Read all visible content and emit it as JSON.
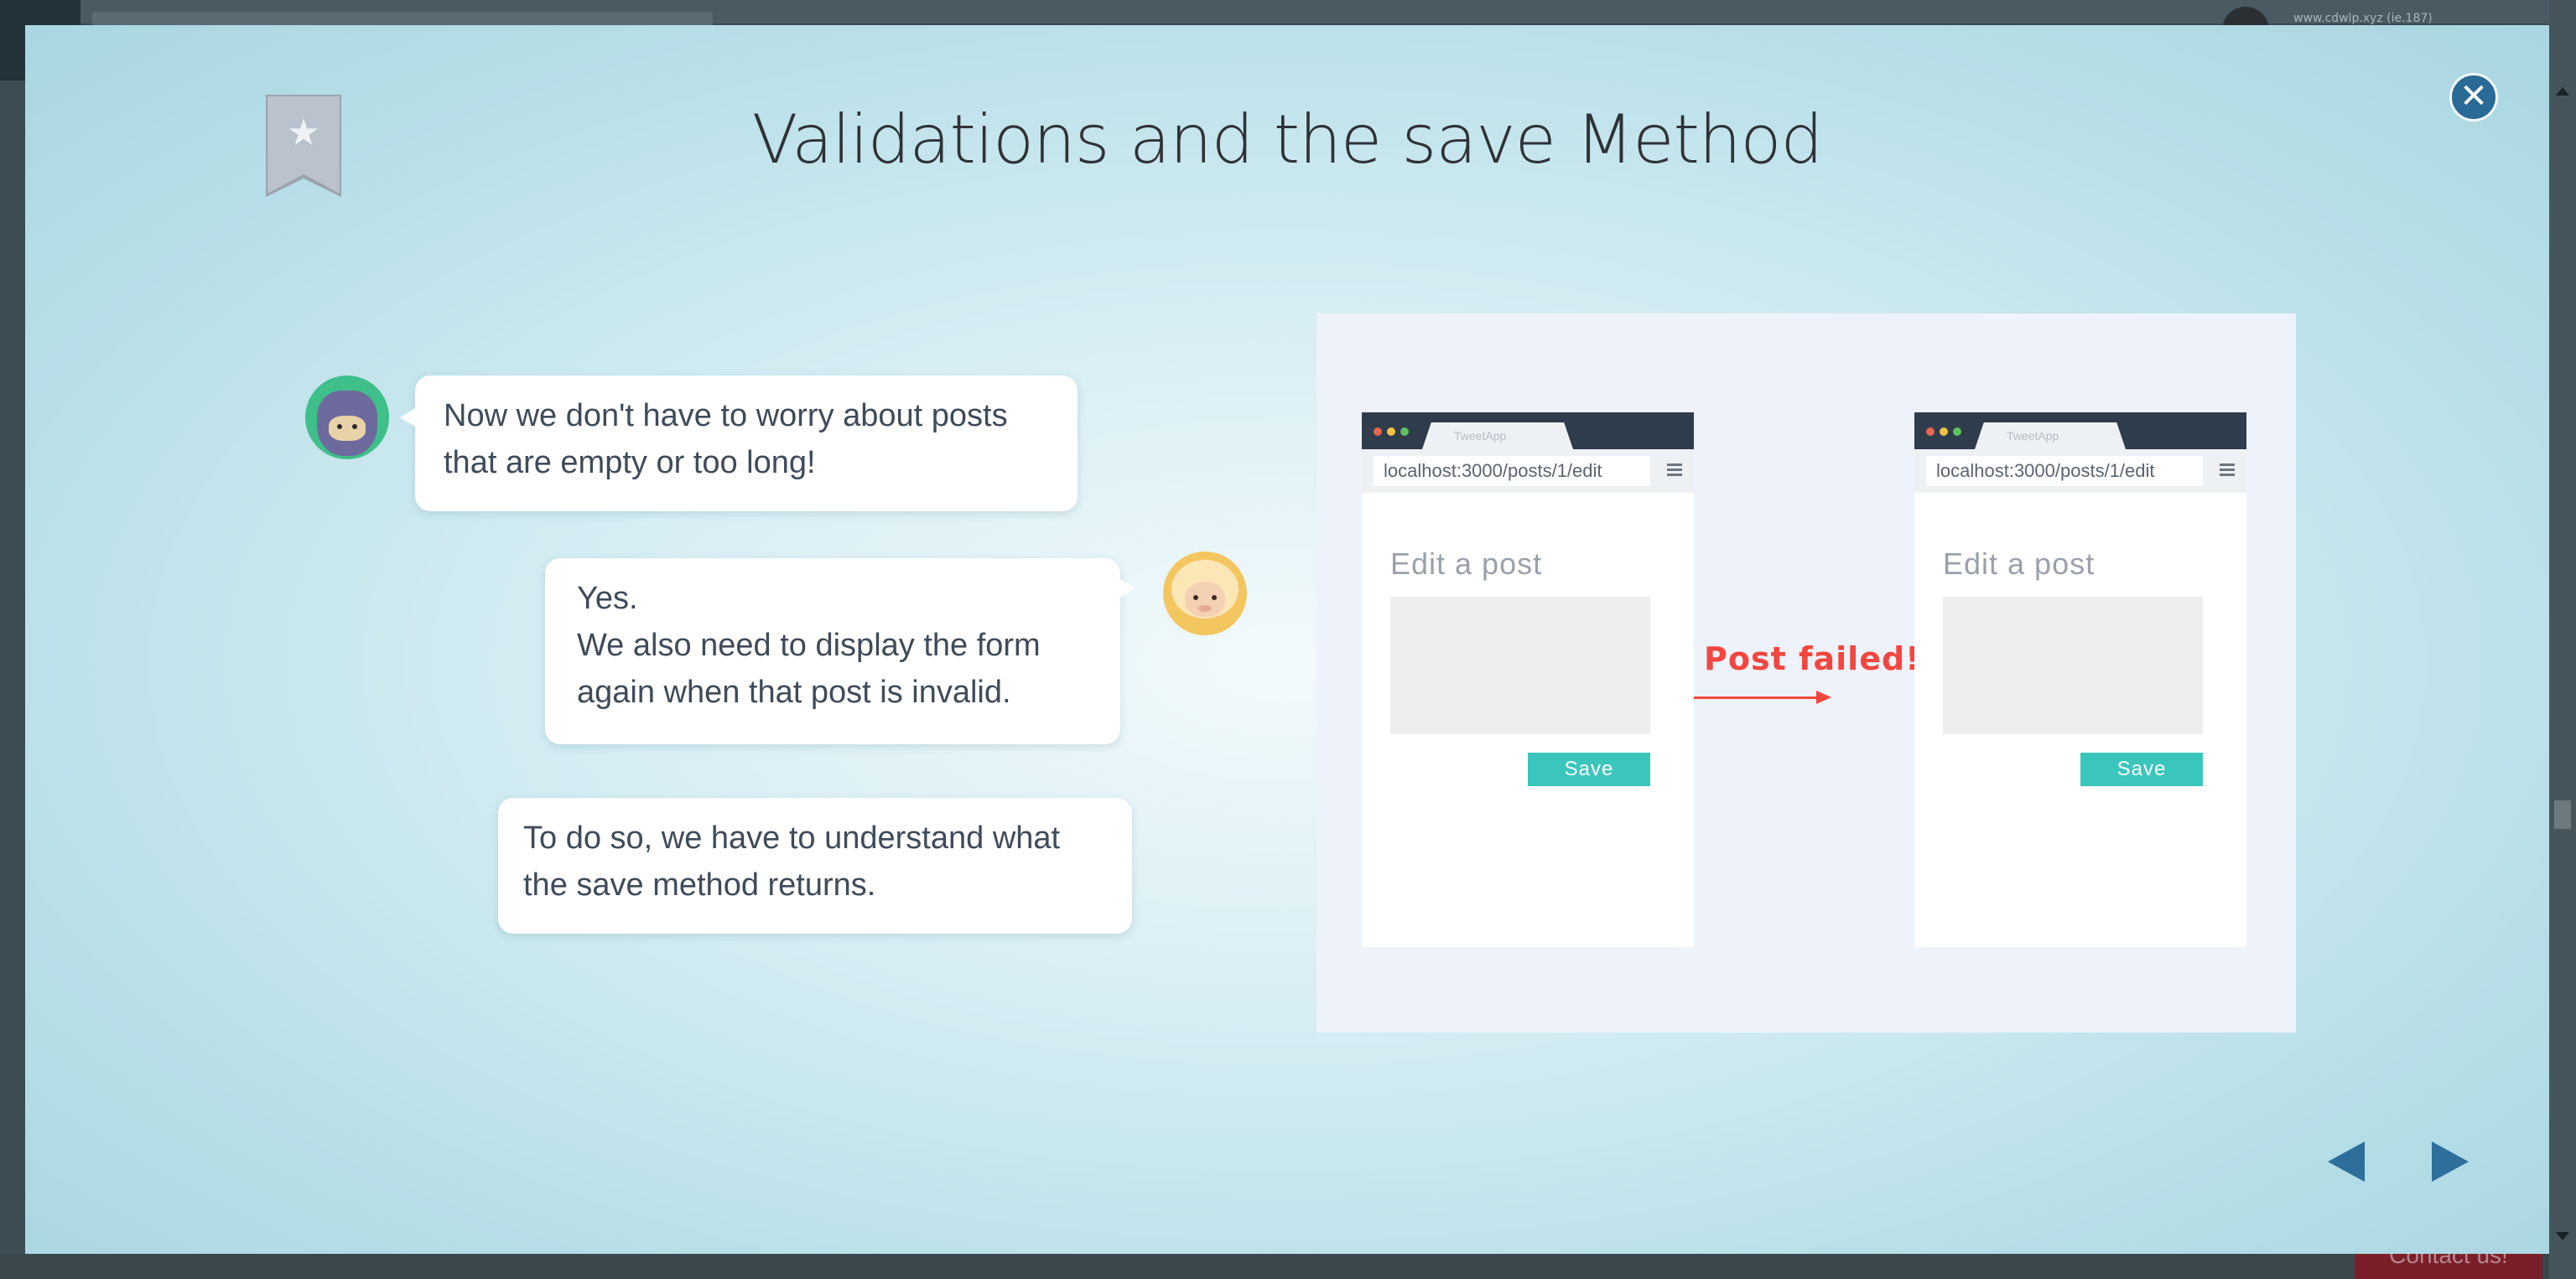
{
  "background_page": {
    "user_text": "www.cdwlp.xyz (ie.187)",
    "contact_label": "Contact us!"
  },
  "slide": {
    "title": "Validations and the save Method",
    "bookmark_icon": "star-bookmark-icon",
    "close_icon": "close-icon",
    "dialogue": [
      {
        "speaker_icon": "ninja-avatar-icon",
        "text": "Now we don't have to worry about posts\nthat are empty or too long!"
      },
      {
        "speaker_icon": "sheep-avatar-icon",
        "text": "Yes.\nWe also need to display the form\nagain when that post is invalid."
      },
      {
        "speaker_icon": "none",
        "text": "To do so, we have to understand what\n the save method returns."
      }
    ],
    "illustration": {
      "left_browser": {
        "tab_title": "TweetApp",
        "address": "localhost:3000/posts/1/edit",
        "heading": "Edit a post",
        "save_label": "Save"
      },
      "arrow_label": "Post failed!",
      "right_browser": {
        "tab_title": "TweetApp",
        "address": "localhost:3000/posts/1/edit",
        "heading": "Edit a post",
        "save_label": "Save"
      }
    },
    "nav": {
      "prev_icon": "triangle-left-icon",
      "next_icon": "triangle-right-icon"
    },
    "colors": {
      "accent": "#2d6f9a",
      "save_button": "#3bc6bd",
      "error": "#f2463f"
    }
  }
}
